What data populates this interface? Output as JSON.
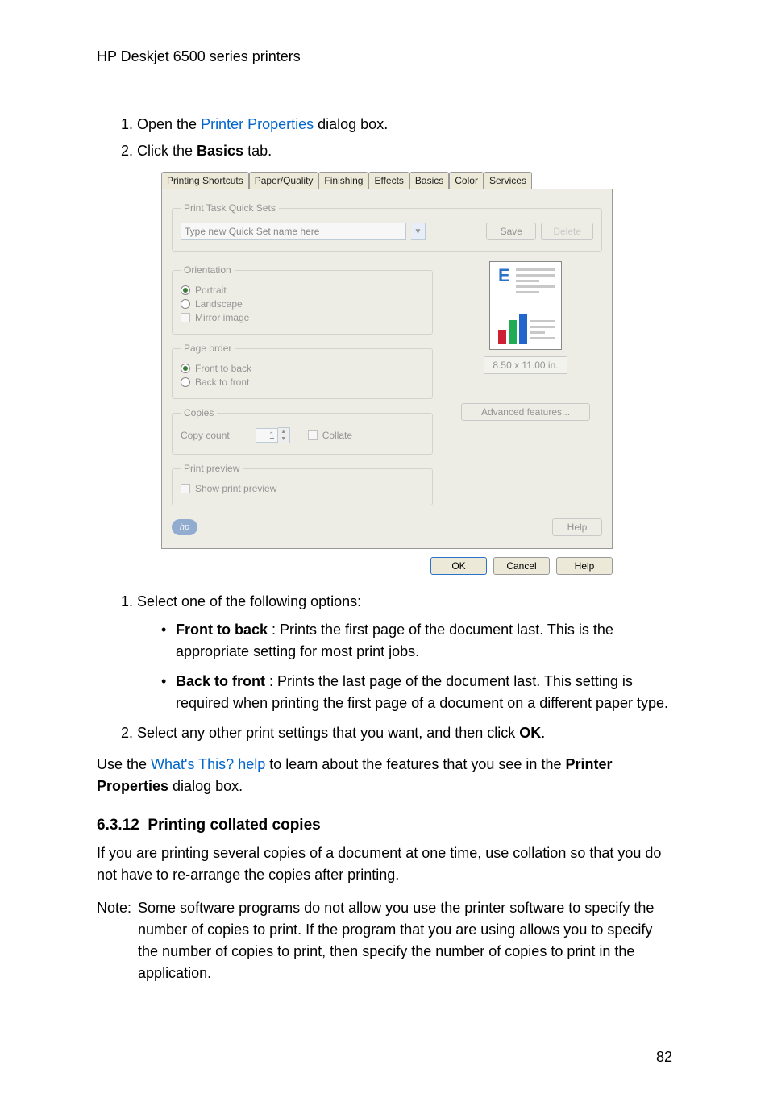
{
  "header": "HP Deskjet 6500 series printers",
  "steps_top": {
    "s1_prefix": "Open the ",
    "s1_link": "Printer Properties",
    "s1_suffix": " dialog box.",
    "s2_prefix": "Click the ",
    "s2_bold": "Basics",
    "s2_suffix": " tab."
  },
  "dialog": {
    "tabs": [
      "Printing Shortcuts",
      "Paper/Quality",
      "Finishing",
      "Effects",
      "Basics",
      "Color",
      "Services"
    ],
    "groups": {
      "quicksets": {
        "legend": "Print Task Quick Sets",
        "input_value": "Type new Quick Set name here",
        "save": "Save",
        "delete": "Delete"
      },
      "orientation": {
        "legend": "Orientation",
        "portrait": "Portrait",
        "landscape": "Landscape",
        "mirror": "Mirror image"
      },
      "page_order": {
        "legend": "Page order",
        "front_to_back": "Front to back",
        "back_to_front": "Back to front"
      },
      "copies": {
        "legend": "Copies",
        "label": "Copy count",
        "value": "1",
        "collate": "Collate"
      },
      "preview": {
        "legend": "Print preview",
        "show": "Show print preview"
      }
    },
    "paper_size": "8.50 x 11.00 in.",
    "advanced": "Advanced features...",
    "help": "Help",
    "hp": "hp",
    "buttons": {
      "ok": "OK",
      "cancel": "Cancel",
      "help": "Help"
    }
  },
  "steps_mid": {
    "s3": "Select one of the following options:",
    "b1_bold": "Front to back",
    "b1_text": " : Prints the first page of the document last. This is the appropriate setting for most print jobs.",
    "b2_bold": "Back to front",
    "b2_text": " : Prints the last page of the document last. This setting is required when printing the first page of a document on a different paper type.",
    "s4_prefix": "Select any other print settings that you want, and then click ",
    "s4_bold": "OK",
    "s4_suffix": "."
  },
  "use_the": {
    "prefix": "Use the ",
    "link": "What's This? help",
    "mid": " to learn about the features that you see in the ",
    "bold": "Printer Properties",
    "suffix": " dialog box."
  },
  "section": {
    "num": "6.3.12",
    "title": "Printing collated copies",
    "para": "If you are printing several copies of a document at one time, use collation so that you do not have to re-arrange the copies after printing."
  },
  "note": {
    "label": "Note:",
    "text": "Some software programs do not allow you use the printer software to specify the number of copies to print. If the program that you are using allows you to specify the number of copies to print, then specify the number of copies to print in the application."
  },
  "page_number": "82"
}
